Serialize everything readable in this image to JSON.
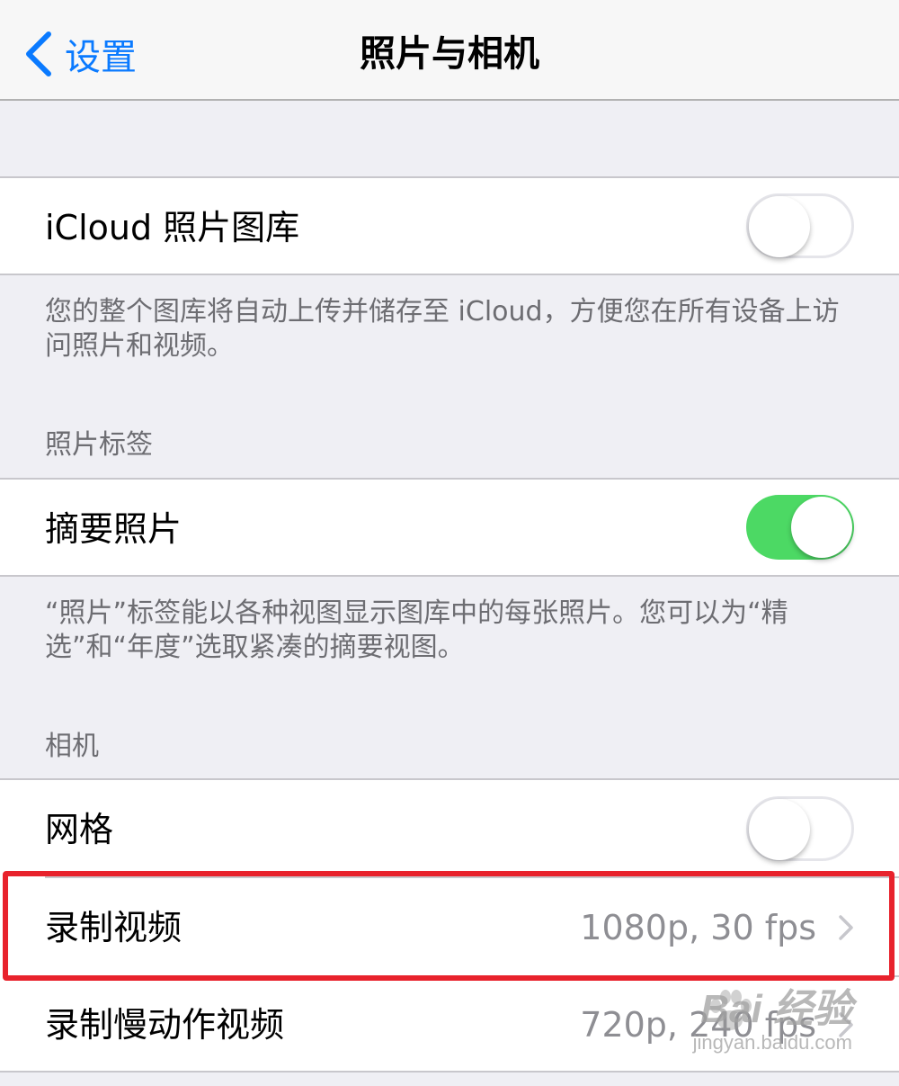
{
  "nav": {
    "back_label": "设置",
    "title": "照片与相机"
  },
  "icloud": {
    "label": "iCloud 照片图库",
    "toggle_on": false,
    "footnote": "您的整个图库将自动上传并储存至 iCloud，方便您在所有设备上访问照片和视频。"
  },
  "photos_tab": {
    "header": "照片标签",
    "summary_label": "摘要照片",
    "toggle_on": true,
    "footnote": "“照片”标签能以各种视图显示图库中的每张照片。您可以为“精选”和“年度”选取紧凑的摘要视图。"
  },
  "camera": {
    "header": "相机",
    "grid_label": "网格",
    "grid_toggle_on": false,
    "record_video_label": "录制视频",
    "record_video_value": "1080p, 30 fps",
    "slomo_label": "录制慢动作视频",
    "slomo_value": "720p, 240 fps"
  },
  "watermark": {
    "brand": "Bai 经验",
    "url": "jingyan.baidu.com"
  },
  "colors": {
    "accent": "#0a7aff",
    "toggle_on": "#4cd964",
    "highlight": "#e8222c",
    "background": "#efeff4"
  }
}
